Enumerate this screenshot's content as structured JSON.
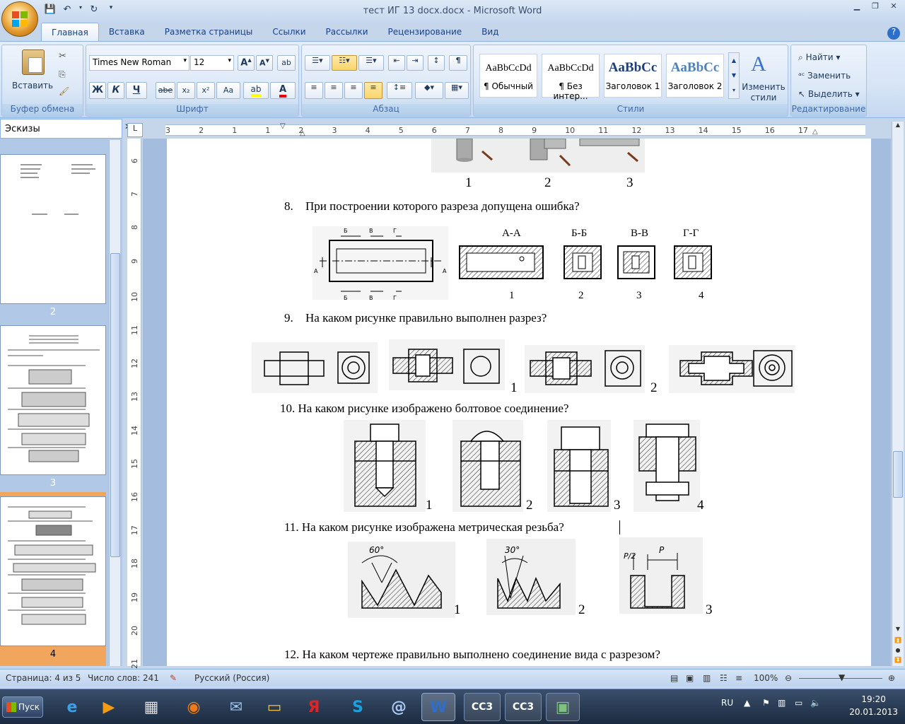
{
  "window": {
    "title": "тест ИГ 13 docx.docx - Microsoft Word"
  },
  "ribbon": {
    "tabs": [
      "Главная",
      "Вставка",
      "Разметка страницы",
      "Ссылки",
      "Рассылки",
      "Рецензирование",
      "Вид"
    ],
    "clipboard": {
      "paste_label": "Вставить",
      "group_label": "Буфер обмена"
    },
    "font": {
      "name": "Times New Roman",
      "size": "12",
      "group_label": "Шрифт",
      "bold": "Ж",
      "italic": "К",
      "underline": "Ч",
      "strike": "abe",
      "subscript": "x₂",
      "superscript": "x²",
      "case": "Aa"
    },
    "paragraph": {
      "group_label": "Абзац"
    },
    "styles": {
      "group_label": "Стили",
      "items": [
        {
          "sample": "AaBbCcDd",
          "name": "¶ Обычный"
        },
        {
          "sample": "AaBbCcDd",
          "name": "¶ Без интер..."
        },
        {
          "sample": "AaBbCc",
          "name": "Заголовок 1"
        },
        {
          "sample": "AaBbCc",
          "name": "Заголовок 2"
        }
      ],
      "change_styles_label": "Изменить стили"
    },
    "editing": {
      "find": "Найти",
      "replace": "Заменить",
      "select": "Выделить",
      "group_label": "Редактирование"
    }
  },
  "thumbnails": {
    "title": "Эскизы",
    "pages": [
      "2",
      "3",
      "4"
    ]
  },
  "ruler": {
    "h_numbers": [
      "3",
      "2",
      "1",
      "1",
      "2",
      "3",
      "4",
      "5",
      "6",
      "7",
      "8",
      "9",
      "10",
      "11",
      "12",
      "13",
      "14",
      "15",
      "16",
      "17"
    ],
    "v_numbers": [
      "6",
      "7",
      "8",
      "9",
      "10",
      "11",
      "12",
      "13",
      "14",
      "15",
      "16",
      "17",
      "18",
      "19",
      "20",
      "21"
    ]
  },
  "document": {
    "top_labels": [
      "1",
      "2",
      "3"
    ],
    "q8": {
      "num": "8.",
      "text": "При построении  которого разреза допущена ошибка?",
      "section_titles": [
        "А-А",
        "Б-Б",
        "В-В",
        "Г-Г"
      ],
      "labels": [
        "1",
        "2",
        "3",
        "4"
      ],
      "marks": [
        "Б",
        "В",
        "Г",
        "А",
        "А",
        "Б",
        "В",
        "Г"
      ]
    },
    "q9": {
      "num": "9.",
      "text": "На каком рисунке правильно выполнен разрез?",
      "labels": [
        "1",
        "2"
      ]
    },
    "q10": {
      "text": "10. На каком рисунке изображено болтовое соединение?",
      "labels": [
        "1",
        "2",
        "3",
        "4"
      ]
    },
    "q11": {
      "text": "11. На каком рисунке изображена метрическая резьба?",
      "labels": [
        "1",
        "2",
        "3"
      ],
      "angles": [
        "60°",
        "30°",
        "P/2",
        "P"
      ]
    },
    "q12": {
      "text": "12. На каком чертеже правильно выполнено соединение вида с разрезом?"
    }
  },
  "status": {
    "page": "Страница: 4 из 5",
    "words": "Число слов: 241",
    "language": "Русский (Россия)",
    "zoom": "100%"
  },
  "taskbar": {
    "start": "Пуск",
    "lang": "RU",
    "time": "19:20",
    "date": "20.01.2013",
    "apps": [
      "ie",
      "media",
      "calc",
      "firefox",
      "mail",
      "folder",
      "yandex",
      "skype",
      "at",
      "word",
      "cc3",
      "cc3",
      "photo"
    ],
    "cc3_label": "CC3",
    "yandex_label": "Я"
  }
}
